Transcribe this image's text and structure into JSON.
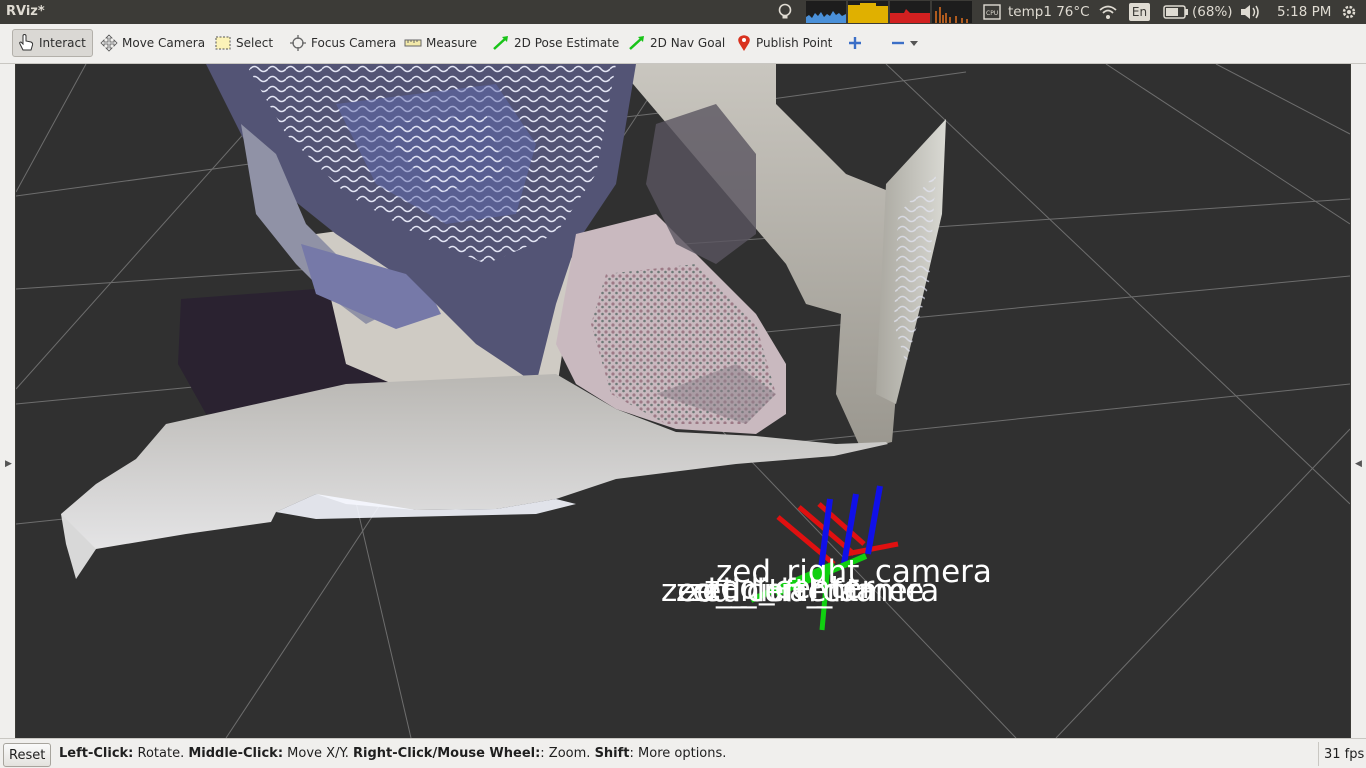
{
  "window": {
    "title": "RViz*"
  },
  "tray": {
    "temperature": "temp1 76°C",
    "keyboard": "En",
    "battery": "(68%)",
    "clock": "5:18 PM",
    "graph_colors": [
      "#4a90d9",
      "#e0b000",
      "#d22020",
      "#e07020"
    ]
  },
  "toolbar": {
    "interact": "Interact",
    "move_camera": "Move Camera",
    "select": "Select",
    "focus_camera": "Focus Camera",
    "measure": "Measure",
    "pose_estimate": "2D Pose Estimate",
    "nav_goal": "2D Nav Goal",
    "publish_point": "Publish Point"
  },
  "viewport": {
    "background": "#303030",
    "grid_color": "#a0a0a0",
    "frames": [
      "zed_right_camera",
      "zed_center",
      "zed_left_camera",
      "zed_current",
      "zed_initial_frame"
    ],
    "axis_colors": {
      "x": "#e01010",
      "y": "#10d010",
      "z": "#1010e8"
    }
  },
  "status": {
    "reset": "Reset",
    "hint_left_click_key": "Left-Click:",
    "hint_left_click": " Rotate. ",
    "hint_middle_click_key": "Middle-Click:",
    "hint_middle_click": " Move X/Y. ",
    "hint_right_click_key": "Right-Click/Mouse Wheel:",
    "hint_right_click": ": Zoom. ",
    "hint_shift_key": "Shift",
    "hint_shift": ": More options.",
    "fps": "31 fps"
  }
}
